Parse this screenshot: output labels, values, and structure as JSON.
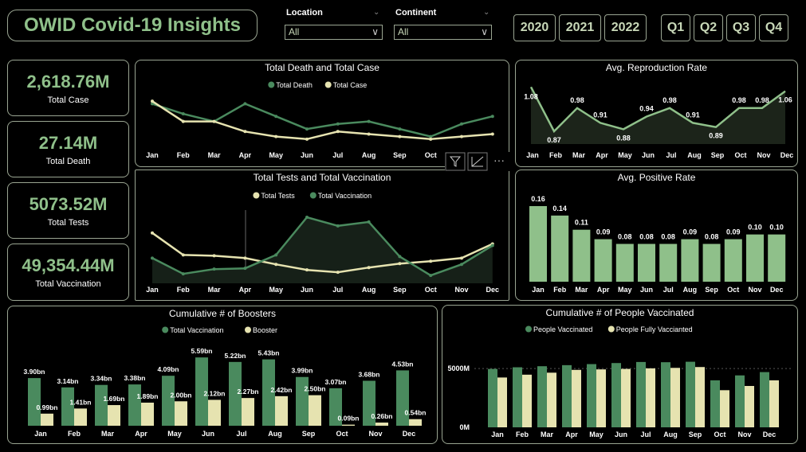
{
  "app": {
    "title": "OWID Covid-19 Insights"
  },
  "filters": {
    "location": {
      "label": "Location",
      "value": "All"
    },
    "continent": {
      "label": "Continent",
      "value": "All"
    }
  },
  "years": [
    "2020",
    "2021",
    "2022"
  ],
  "quarters": [
    "Q1",
    "Q2",
    "Q3",
    "Q4"
  ],
  "kpis": [
    {
      "value": "2,618.76M",
      "label": "Total Case"
    },
    {
      "value": "27.14M",
      "label": "Total Death"
    },
    {
      "value": "5073.52M",
      "label": "Total Tests"
    },
    {
      "value": "49,354.44M",
      "label": "Total Vaccination"
    }
  ],
  "colors": {
    "dark_green": "#4a8a5e",
    "light": "#e6e3b0",
    "green_bar": "#8fc08a",
    "border": "#9aa592"
  },
  "chart_data": [
    {
      "type": "line",
      "title": "Total Death and Total Case",
      "categories": [
        "Jan",
        "Feb",
        "Mar",
        "Apr",
        "May",
        "Jun",
        "Jul",
        "Aug",
        "Sep",
        "Oct",
        "Nov",
        "Dec"
      ],
      "series": [
        {
          "name": "Total Death",
          "color": "#4a8a5e",
          "values": [
            2.9,
            2.5,
            2.2,
            2.9,
            2.4,
            1.9,
            2.1,
            2.2,
            1.9,
            1.6,
            2.1,
            2.4
          ]
        },
        {
          "name": "Total Case",
          "color": "#e6e3b0",
          "values": [
            3.0,
            2.2,
            2.2,
            1.8,
            1.6,
            1.5,
            1.8,
            1.7,
            1.6,
            1.5,
            1.6,
            1.7
          ]
        }
      ]
    },
    {
      "type": "area",
      "title": "Avg. Reproduction Rate",
      "categories": [
        "Jan",
        "Feb",
        "Mar",
        "Apr",
        "May",
        "Jun",
        "Jul",
        "Aug",
        "Sep",
        "Oct",
        "Nov",
        "Dec"
      ],
      "series": [
        {
          "name": "",
          "color": "#8fc08a",
          "values": [
            1.08,
            0.87,
            0.98,
            0.91,
            0.88,
            0.94,
            0.98,
            0.91,
            0.89,
            0.98,
            0.98,
            1.06
          ]
        }
      ],
      "data_labels": [
        "1.08",
        "0.87",
        "0.98",
        "0.91",
        "0.88",
        "0.94",
        "0.98",
        "0.91",
        "0.89",
        "0.98",
        "0.98",
        "1.06"
      ]
    },
    {
      "type": "area",
      "title": "Total Tests and Total Vaccination",
      "categories": [
        "Jan",
        "Feb",
        "Mar",
        "Apr",
        "May",
        "Jun",
        "Jul",
        "Aug",
        "Sep",
        "Oct",
        "Nov",
        "Dec"
      ],
      "series": [
        {
          "name": "Total Tests",
          "color": "#e6e3b0",
          "values": [
            3.0,
            1.6,
            1.55,
            1.4,
            1.0,
            0.65,
            0.5,
            0.8,
            1.05,
            1.2,
            1.4,
            2.3
          ]
        },
        {
          "name": "Total Vaccination",
          "color": "#4a8a5e",
          "values": [
            1.4,
            0.4,
            0.7,
            0.75,
            1.6,
            4.0,
            3.45,
            3.7,
            1.5,
            0.3,
            1.0,
            2.2
          ]
        }
      ]
    },
    {
      "type": "bar",
      "title": "Avg. Positive Rate",
      "categories": [
        "Jan",
        "Feb",
        "Mar",
        "Apr",
        "May",
        "Jun",
        "Jul",
        "Aug",
        "Sep",
        "Oct",
        "Nov",
        "Dec"
      ],
      "values": [
        0.16,
        0.14,
        0.11,
        0.09,
        0.08,
        0.08,
        0.08,
        0.09,
        0.08,
        0.09,
        0.1,
        0.1
      ],
      "data_labels": [
        "0.16",
        "0.14",
        "0.11",
        "0.09",
        "0.08",
        "0.08",
        "0.08",
        "0.09",
        "0.08",
        "0.09",
        "0.10",
        "0.10"
      ]
    },
    {
      "type": "bar",
      "title": "Cumulative # of Boosters",
      "categories": [
        "Jan",
        "Feb",
        "Mar",
        "Apr",
        "May",
        "Jun",
        "Jul",
        "Aug",
        "Sep",
        "Oct",
        "Nov",
        "Dec"
      ],
      "series": [
        {
          "name": "Total Vaccination",
          "color": "#4a8a5e",
          "values": [
            3.9,
            3.14,
            3.34,
            3.38,
            4.09,
            5.59,
            5.22,
            5.43,
            3.99,
            3.07,
            3.68,
            4.53
          ],
          "labels": [
            "3.90bn",
            "3.14bn",
            "3.34bn",
            "3.38bn",
            "4.09bn",
            "5.59bn",
            "5.22bn",
            "5.43bn",
            "3.99bn",
            "3.07bn",
            "3.68bn",
            "4.53bn"
          ]
        },
        {
          "name": "Booster",
          "color": "#e6e3b0",
          "values": [
            0.99,
            1.41,
            1.69,
            1.89,
            2.0,
            2.12,
            2.27,
            2.42,
            2.5,
            0.09,
            0.26,
            0.54
          ],
          "labels": [
            "0.99bn",
            "1.41bn",
            "1.69bn",
            "1.89bn",
            "2.00bn",
            "2.12bn",
            "2.27bn",
            "2.42bn",
            "2.50bn",
            "0.09bn",
            "0.26bn",
            "0.54bn"
          ]
        }
      ]
    },
    {
      "type": "bar",
      "title": "Cumulative # of People Vaccinated",
      "categories": [
        "Jan",
        "Feb",
        "Mar",
        "Apr",
        "May",
        "Jun",
        "Jul",
        "Aug",
        "Sep",
        "Oct",
        "Nov",
        "Dec"
      ],
      "yticks": [
        "5000M",
        "0M"
      ],
      "ylim": [
        0,
        6500
      ],
      "series": [
        {
          "name": "People Vaccinated",
          "color": "#4a8a5e",
          "values": [
            4970,
            5110,
            5200,
            5290,
            5380,
            5470,
            5560,
            5540,
            5580,
            4000,
            4420,
            4700
          ]
        },
        {
          "name": "People Fully Vaccianted",
          "color": "#e6e3b0",
          "values": [
            4240,
            4480,
            4650,
            4890,
            4930,
            4970,
            5020,
            5060,
            5130,
            3160,
            3520,
            4000
          ]
        }
      ]
    }
  ]
}
